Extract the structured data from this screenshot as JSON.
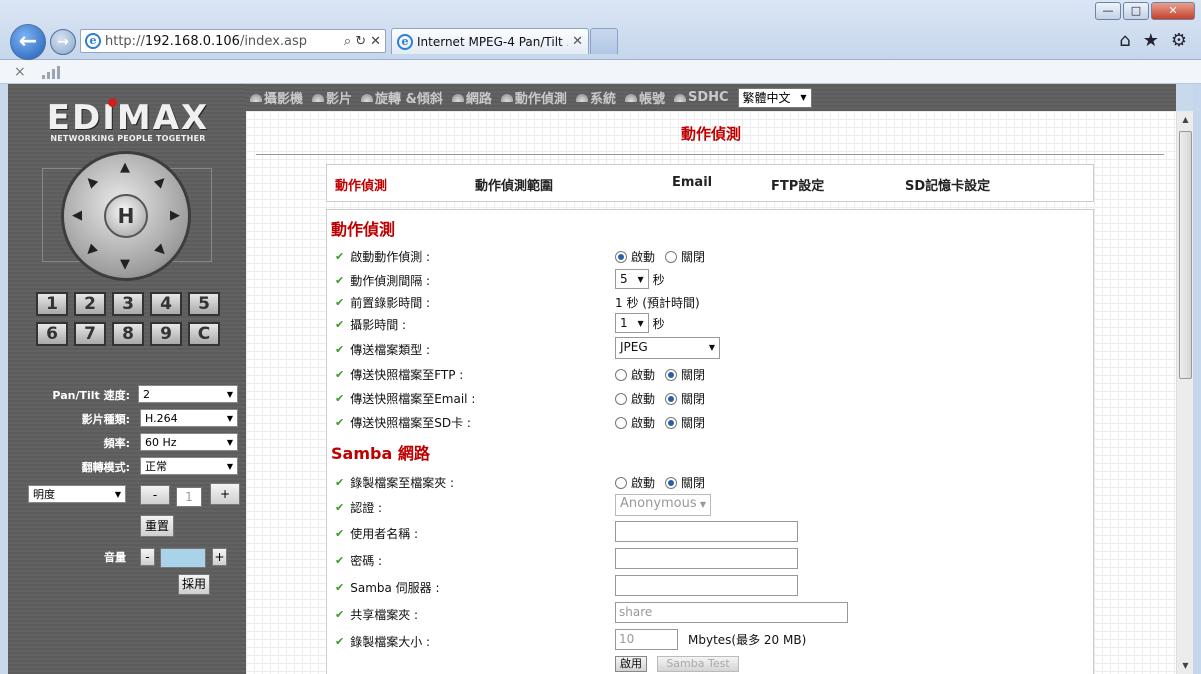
{
  "browser": {
    "url_prefix": "http://",
    "url_host": "192.168.0.106",
    "url_path": "/index.asp",
    "tab_title": "Internet MPEG-4 Pan/Tilt ...",
    "window_buttons": [
      "—",
      "□",
      "✕"
    ],
    "right_icons": [
      "⌂",
      "★",
      "⚙"
    ]
  },
  "brand": {
    "logo": "EDIMAX",
    "tagline": "NETWORKING PEOPLE TOGETHER",
    "accent_color": "#c00000"
  },
  "ptz": {
    "home_label": "H",
    "presets": [
      "1",
      "2",
      "3",
      "4",
      "5",
      "6",
      "7",
      "8",
      "9",
      "C"
    ]
  },
  "left_controls": {
    "pan_tilt_speed_label": "Pan/Tilt 速度:",
    "pan_tilt_speed_value": "2",
    "video_type_label": "影片種類:",
    "video_type_value": "H.264",
    "frequency_label": "頻率:",
    "frequency_value": "60 Hz",
    "flip_mode_label": "翻轉模式:",
    "flip_mode_value": "正常",
    "brightness_select": "明度",
    "brightness_minus": "-",
    "brightness_value": "1",
    "brightness_plus": "+",
    "reset_button": "重置",
    "volume_label": "音量",
    "volume_minus": "-",
    "volume_plus": "+",
    "apply_button": "採用"
  },
  "top_menu": {
    "items": [
      "攝影機",
      "影片",
      "旋轉 &傾斜",
      "網路",
      "動作偵測",
      "系統",
      "帳號",
      "SDHC"
    ],
    "language": "繁體中文"
  },
  "page": {
    "title": "動作偵測",
    "sub_tabs": [
      "動作偵測",
      "動作偵測範圍",
      "Email",
      "FTP設定",
      "SD記憶卡設定"
    ]
  },
  "motion": {
    "section_title": "動作偵測",
    "enable_label": "啟動動作偵測 :",
    "interval_label": "動作偵測間隔 :",
    "interval_value": "5",
    "interval_unit": "秒",
    "pre_record_label": "前置錄影時間 :",
    "pre_record_value": "1 秒 (預計時間)",
    "record_time_label": "攝影時間 :",
    "record_time_value": "1",
    "record_time_unit": "秒",
    "file_type_label": "傳送檔案類型 :",
    "file_type_value": "JPEG",
    "ftp_label": "傳送快照檔案至FTP :",
    "email_label": "傳送快照檔案至Email :",
    "sd_label": "傳送快照檔案至SD卡 :",
    "on_text": "啟動",
    "off_text": "關閉"
  },
  "samba": {
    "section_title": "Samba 網路",
    "record_folder_label": "錄製檔案至檔案夾 :",
    "auth_label": "認證 :",
    "auth_value": "Anonymous",
    "username_label": "使用者名稱 :",
    "password_label": "密碼 :",
    "server_label": "Samba 伺服器 :",
    "share_label": "共享檔案夾 :",
    "share_value": "share",
    "size_label": "錄製檔案大小 :",
    "size_value": "10",
    "size_unit": "Mbytes(最多 20 MB)",
    "enable_button": "啟用",
    "test_button": "Samba Test"
  }
}
